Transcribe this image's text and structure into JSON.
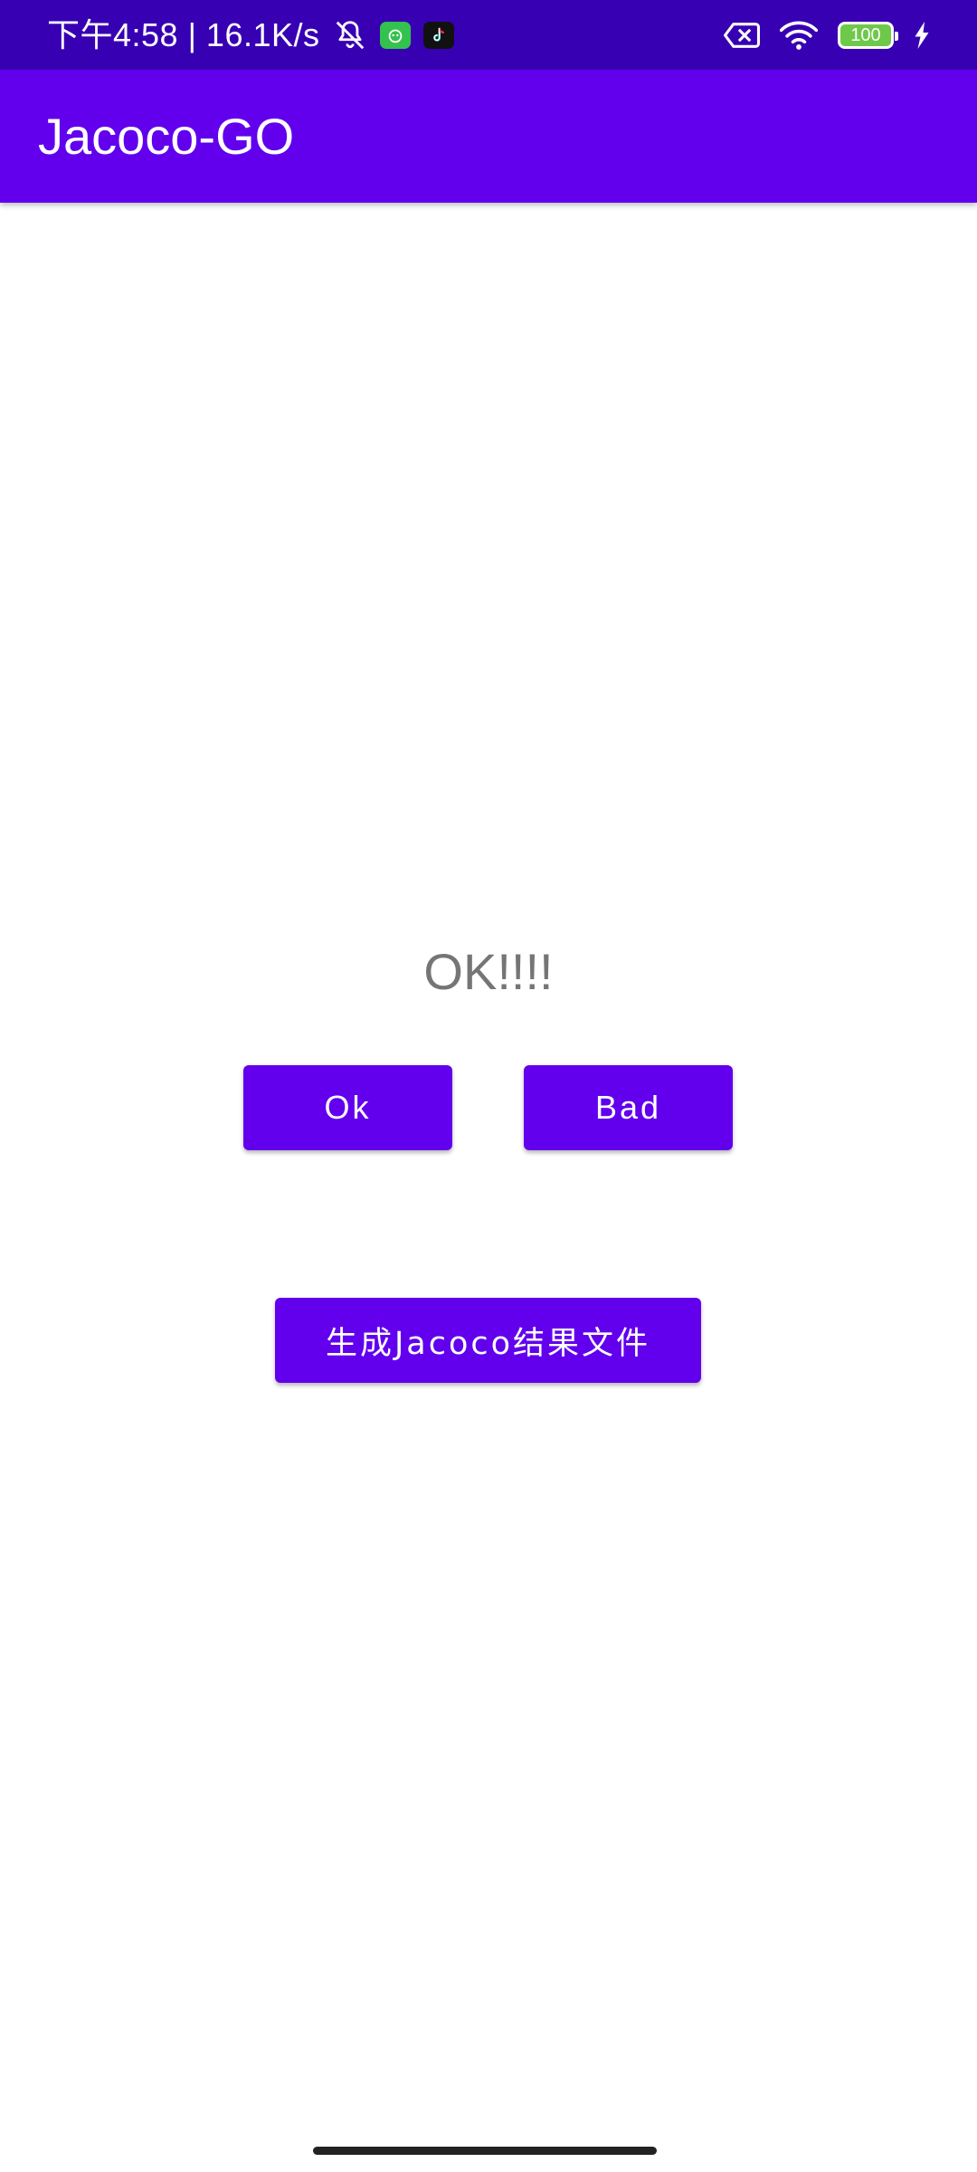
{
  "status_bar": {
    "time_and_speed": "下午4:58 | 16.1K/s",
    "battery_level": "100",
    "background_color": "#3700b3",
    "icons": [
      "mute-bell-icon",
      "green-app-icon",
      "tiktok-icon",
      "no-sim-icon",
      "wifi-icon",
      "battery-icon",
      "charging-icon"
    ]
  },
  "toolbar": {
    "title": "Jacoco-GO",
    "background_color": "#6200ee"
  },
  "main": {
    "result_text": "OK!!!!",
    "ok_button_label": "Ok",
    "bad_button_label": "Bad",
    "generate_button_label": "生成Jacoco结果文件",
    "button_color": "#6200ee"
  }
}
